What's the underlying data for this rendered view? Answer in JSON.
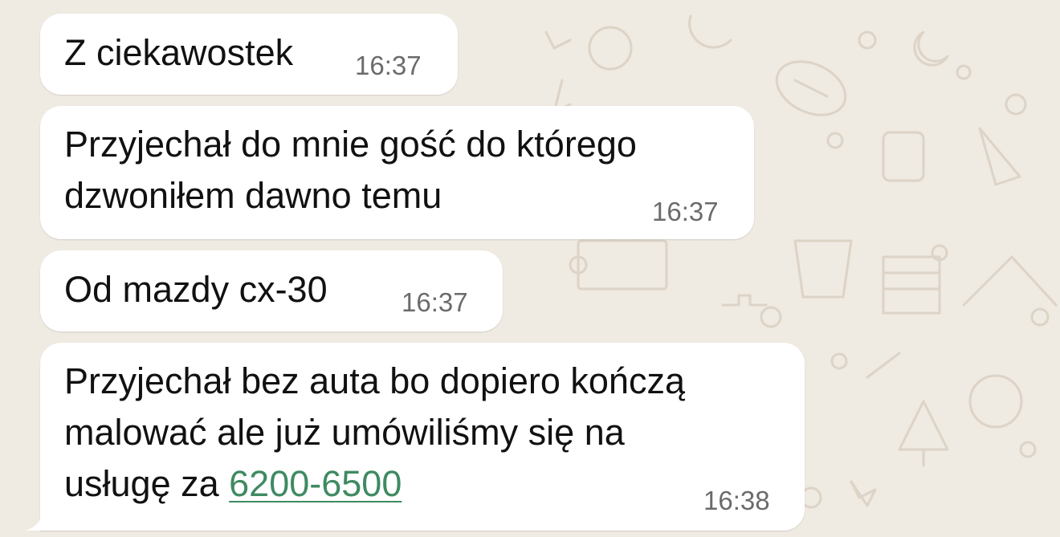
{
  "chat": {
    "messages": [
      {
        "lines": [
          "Z ciekawostek"
        ],
        "time": "16:37"
      },
      {
        "lines": [
          "Przyjechał do mnie gość do którego",
          "dzwoniłem dawno temu"
        ],
        "time": "16:37"
      },
      {
        "lines": [
          "Od mazdy cx-30"
        ],
        "time": "16:37"
      },
      {
        "lines": [
          "Przyjechał bez auta bo dopiero kończą",
          "malować ale już umówiliśmy się na"
        ],
        "line3_prefix": "usługę za ",
        "link": "6200-6500",
        "time": "16:38"
      }
    ]
  },
  "colors": {
    "wallpaper": "#efeae2",
    "bubble": "#ffffff",
    "text": "#111111",
    "timestamp": "#6b6b6b",
    "link": "#3f8a62"
  }
}
